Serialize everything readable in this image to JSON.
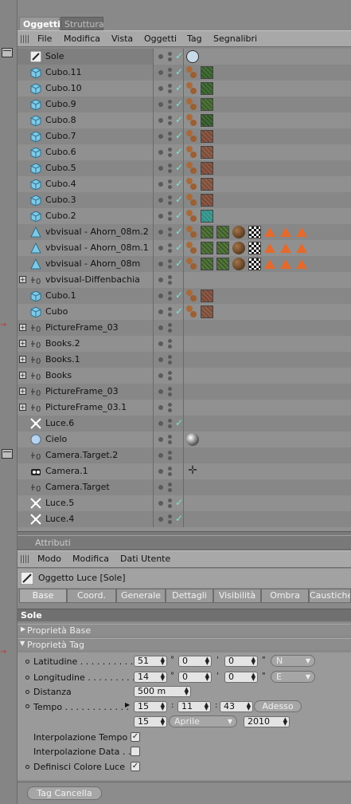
{
  "tabs": {
    "active": "Oggetti",
    "inactive": "Struttura"
  },
  "menu": [
    "File",
    "Modifica",
    "Vista",
    "Oggetti",
    "Tag",
    "Segnalibri"
  ],
  "objects": [
    {
      "name": "Sole",
      "icon": "light-icon",
      "expand": false,
      "check": true,
      "tags": [
        "sun-tag-icon"
      ]
    },
    {
      "name": "Cubo.11",
      "icon": "cube-icon",
      "expand": false,
      "check": true,
      "tags": [
        "phong-tag-icon",
        "texture-tag-icon"
      ]
    },
    {
      "name": "Cubo.10",
      "icon": "cube-icon",
      "expand": false,
      "check": true,
      "tags": [
        "phong-tag-icon",
        "texture-tag-icon"
      ]
    },
    {
      "name": "Cubo.9",
      "icon": "cube-icon",
      "expand": false,
      "check": true,
      "tags": [
        "phong-tag-icon",
        "texture-tag-icon"
      ]
    },
    {
      "name": "Cubo.8",
      "icon": "cube-icon",
      "expand": false,
      "check": true,
      "tags": [
        "phong-tag-icon",
        "texture-tag-icon"
      ]
    },
    {
      "name": "Cubo.7",
      "icon": "cube-icon",
      "expand": false,
      "check": true,
      "tags": [
        "phong-tag-icon",
        "texture-tag-icon"
      ]
    },
    {
      "name": "Cubo.6",
      "icon": "cube-icon",
      "expand": false,
      "check": true,
      "tags": [
        "phong-tag-icon",
        "texture-tag-icon"
      ]
    },
    {
      "name": "Cubo.5",
      "icon": "cube-icon",
      "expand": false,
      "check": true,
      "tags": [
        "phong-tag-icon",
        "texture-tag-icon"
      ]
    },
    {
      "name": "Cubo.4",
      "icon": "cube-icon",
      "expand": false,
      "check": true,
      "tags": [
        "phong-tag-icon",
        "texture-tag-icon"
      ]
    },
    {
      "name": "Cubo.3",
      "icon": "cube-icon",
      "expand": false,
      "check": true,
      "tags": [
        "phong-tag-icon",
        "texture-tag-icon"
      ]
    },
    {
      "name": "Cubo.2",
      "icon": "cube-icon",
      "expand": false,
      "check": true,
      "tags": [
        "phong-tag-icon",
        "texture-tag-icon"
      ]
    },
    {
      "name": "vbvisual - Ahorn_08m.2",
      "icon": "polygon-icon",
      "expand": false,
      "check": true,
      "tags": [
        "phong-tag-icon",
        "texture-tag-icon",
        "texture-tag-icon",
        "ball-tag-icon",
        "checker-tag-icon",
        "triangle-tag-icon",
        "triangle-tag-icon",
        "triangle-tag-icon"
      ]
    },
    {
      "name": "vbvisual - Ahorn_08m.1",
      "icon": "polygon-icon",
      "expand": false,
      "check": true,
      "tags": [
        "phong-tag-icon",
        "texture-tag-icon",
        "texture-tag-icon",
        "ball-tag-icon",
        "checker-tag-icon",
        "triangle-tag-icon",
        "triangle-tag-icon",
        "triangle-tag-icon"
      ]
    },
    {
      "name": "vbvisual - Ahorn_08m",
      "icon": "polygon-icon",
      "expand": false,
      "check": true,
      "tags": [
        "phong-tag-icon",
        "texture-tag-icon",
        "texture-tag-icon",
        "ball-tag-icon",
        "checker-tag-icon",
        "triangle-tag-icon",
        "triangle-tag-icon",
        "triangle-tag-icon"
      ]
    },
    {
      "name": "vbvisual-Diffenbachia",
      "icon": "null-icon",
      "expand": true,
      "check": false,
      "tags": []
    },
    {
      "name": "Cubo.1",
      "icon": "cube-icon",
      "expand": false,
      "check": true,
      "tags": [
        "phong-tag-icon",
        "texture-tag-icon"
      ]
    },
    {
      "name": "Cubo",
      "icon": "cube-icon",
      "expand": false,
      "check": true,
      "tags": [
        "phong-tag-icon",
        "texture-tag-icon"
      ]
    },
    {
      "name": "PictureFrame_03",
      "icon": "null-icon",
      "expand": true,
      "check": false,
      "tags": []
    },
    {
      "name": "Books.2",
      "icon": "null-icon",
      "expand": true,
      "check": false,
      "tags": []
    },
    {
      "name": "Books.1",
      "icon": "null-icon",
      "expand": true,
      "check": false,
      "tags": []
    },
    {
      "name": "Books",
      "icon": "null-icon",
      "expand": true,
      "check": false,
      "tags": []
    },
    {
      "name": "PictureFrame_03",
      "icon": "null-icon",
      "expand": true,
      "check": false,
      "tags": []
    },
    {
      "name": "PictureFrame_03.1",
      "icon": "null-icon",
      "expand": true,
      "check": false,
      "tags": []
    },
    {
      "name": "Luce.6",
      "icon": "omni-light-icon",
      "expand": false,
      "check": true,
      "tags": []
    },
    {
      "name": "Cielo",
      "icon": "sky-icon",
      "expand": false,
      "check": false,
      "tags": [
        "sky-material-tag-icon"
      ]
    },
    {
      "name": "Camera.Target.2",
      "icon": "null-icon",
      "expand": false,
      "check": false,
      "tags": []
    },
    {
      "name": "Camera.1",
      "icon": "camera-icon",
      "expand": false,
      "check": false,
      "tags": [
        "target-tag-icon"
      ]
    },
    {
      "name": "Camera.Target",
      "icon": "null-icon",
      "expand": false,
      "check": false,
      "tags": []
    },
    {
      "name": "Luce.5",
      "icon": "omni-light-icon",
      "expand": false,
      "check": true,
      "tags": []
    },
    {
      "name": "Luce.4",
      "icon": "omni-light-icon",
      "expand": false,
      "check": true,
      "tags": []
    }
  ],
  "attributes": {
    "header": "Attributi",
    "menu": [
      "Modo",
      "Modifica",
      "Dati Utente"
    ],
    "object_title": "Oggetto Luce [Sole]",
    "tabs": [
      "Base",
      "Coord.",
      "Generale",
      "Dettagli",
      "Visibilità",
      "Ombra",
      "Caustiche"
    ],
    "section": "Sole",
    "group_base": "Proprietà Base",
    "group_tag": "Proprietà Tag",
    "latitudine": {
      "label": "Latitudine . . . . . . . . . . .",
      "deg": "51",
      "min": "0",
      "sec": "0",
      "dir": "N"
    },
    "longitudine": {
      "label": "Longitudine . . . . . . . . .",
      "deg": "14",
      "min": "0",
      "sec": "0",
      "dir": "E"
    },
    "distanza": {
      "label": "Distanza",
      "value": "500 m"
    },
    "tempo": {
      "label": "Tempo . . . . . . . . . . . .",
      "h": "15",
      "m": "11",
      "s": "43",
      "now_button": "Adesso",
      "day": "15",
      "month": "Aprile",
      "year": "2010"
    },
    "interp_tempo": {
      "label": "Interpolazione Tempo",
      "checked": true
    },
    "interp_data": {
      "label": "Interpolazione Data . .",
      "checked": false
    },
    "colore_luce": {
      "label": "Definisci Colore Luce",
      "checked": true
    },
    "units": {
      "deg": "°",
      "min": "'",
      "sec": "\"",
      "colon": ":"
    },
    "bottom_button": "Tag Cancella"
  }
}
